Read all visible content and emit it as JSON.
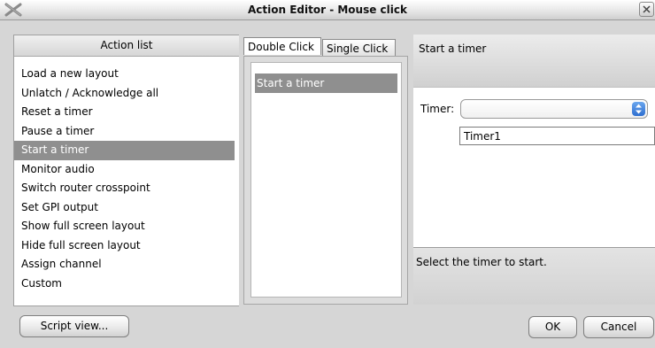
{
  "window": {
    "title": "Action Editor - Mouse click"
  },
  "left": {
    "header": "Action list",
    "items": [
      "Load a new layout",
      "Unlatch / Acknowledge all",
      "Reset a timer",
      "Pause a timer",
      "Start a timer",
      "Monitor audio",
      "Switch router crosspoint",
      "Set GPI output",
      "Show full screen layout",
      "Hide full screen layout",
      "Assign channel",
      "Custom"
    ],
    "selected_index": 4
  },
  "middle": {
    "tabs": [
      "Double Click",
      "Single Click"
    ],
    "items": [
      "Start a timer"
    ]
  },
  "right": {
    "header": "Start a timer",
    "timer_label": "Timer:",
    "timer_value": "",
    "timer_option": "Timer1",
    "description": "Select the timer to start."
  },
  "buttons": {
    "script": "Script view...",
    "ok": "OK",
    "cancel": "Cancel"
  },
  "colors": {
    "selection": "#8f8f8f",
    "spinner": "#2f6fd0"
  }
}
